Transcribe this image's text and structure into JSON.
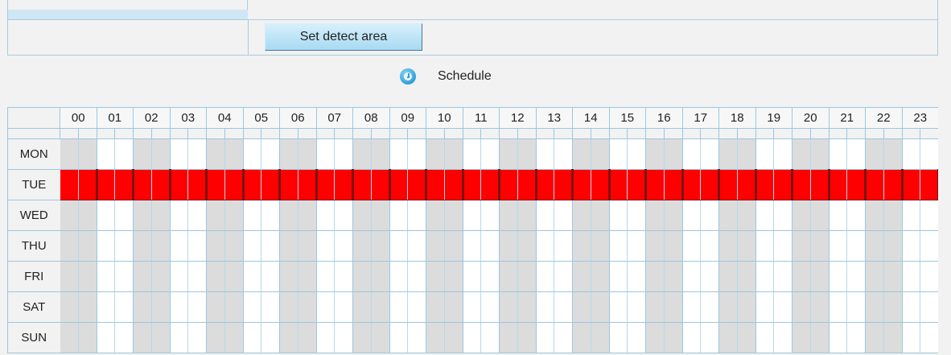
{
  "detect_area": {
    "button_label": "Set detect area"
  },
  "schedule": {
    "title": "Schedule",
    "icon": "clock-icon",
    "hours": [
      "00",
      "01",
      "02",
      "03",
      "04",
      "05",
      "06",
      "07",
      "08",
      "09",
      "10",
      "11",
      "12",
      "13",
      "14",
      "15",
      "16",
      "17",
      "18",
      "19",
      "20",
      "21",
      "22",
      "23"
    ],
    "days": [
      {
        "label": "MON",
        "active_hours": []
      },
      {
        "label": "TUE",
        "active_hours": [
          "00",
          "01",
          "02",
          "03",
          "04",
          "05",
          "06",
          "07",
          "08",
          "09",
          "10",
          "11",
          "12",
          "13",
          "14",
          "15",
          "16",
          "17",
          "18",
          "19",
          "20",
          "21",
          "22",
          "23"
        ]
      },
      {
        "label": "WED",
        "active_hours": []
      },
      {
        "label": "THU",
        "active_hours": []
      },
      {
        "label": "FRI",
        "active_hours": []
      },
      {
        "label": "SAT",
        "active_hours": []
      },
      {
        "label": "SUN",
        "active_hours": []
      }
    ],
    "colors": {
      "active": "#ff0000",
      "grid_line": "#9cc7e0",
      "shaded_column": "#dcdcdc"
    }
  }
}
